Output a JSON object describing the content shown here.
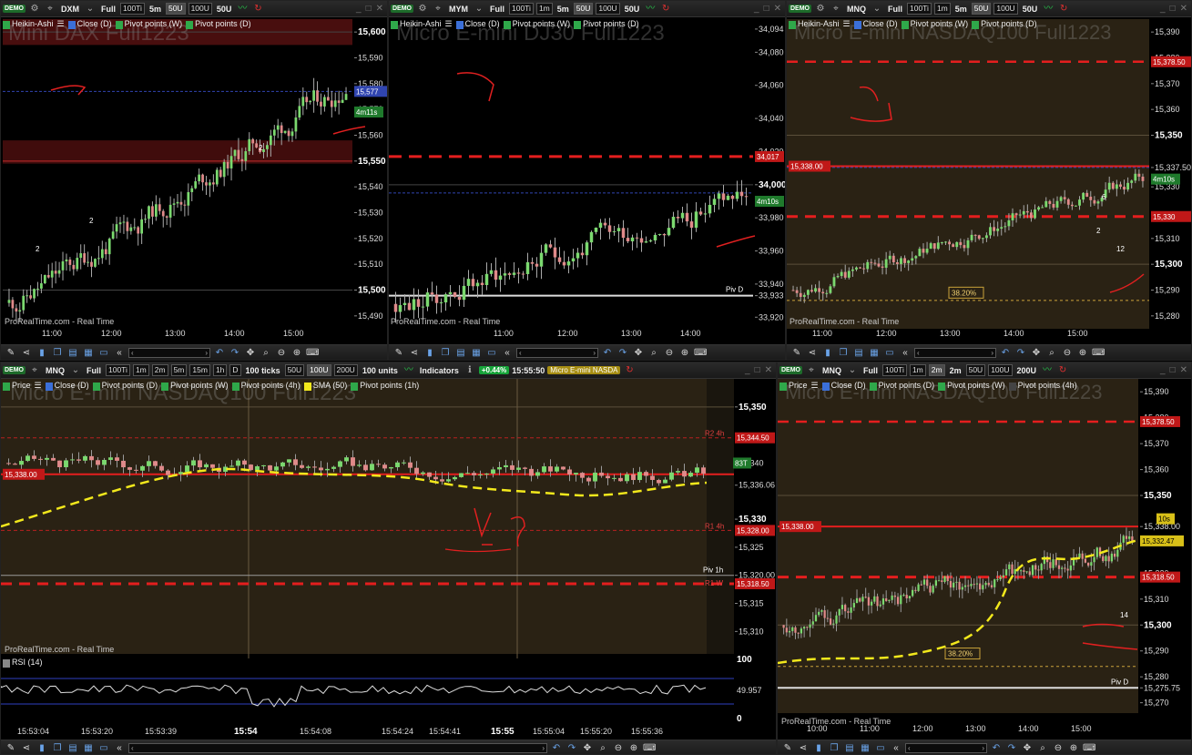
{
  "colors": {
    "up": "#7bd96f",
    "down": "#e08a8a",
    "pivot_red": "#e41e1e",
    "sma_yellow": "#f2e81c",
    "bg_dark": "#000000",
    "bg_brown": "#2a2214",
    "rsi_blue": "#3040c0"
  },
  "panels": [
    {
      "id": "dax",
      "toolbar": {
        "symbol": "DXM",
        "mode": "Full",
        "ticks": "100Ti",
        "interval": "5m",
        "units": [
          "50U",
          "100U",
          "50U"
        ]
      },
      "legend": [
        {
          "color": "#2fa84a",
          "label": "Heikin-Ashi"
        },
        {
          "color": "#3b6fd8",
          "label": "Close (D)"
        },
        {
          "color": "#2fa84a",
          "label": "Pivot points (W)"
        },
        {
          "color": "#2fa84a",
          "label": "Pivot points (D)"
        }
      ],
      "watermark": "Mini DAX Full1223",
      "source_label": "ProRealTime.com - Real Time",
      "y_ticks": [
        "15,600",
        "15,590",
        "15,580",
        "15,570",
        "15,560",
        "15,550",
        "15,540",
        "15,530",
        "15,520",
        "15,510",
        "15,500",
        "15,490"
      ],
      "x_ticks": [
        "11:00",
        "12:00",
        "13:00",
        "14:00",
        "15:00"
      ],
      "price_tags": [
        "15,577",
        "4m11s"
      ],
      "annotations": [
        "2",
        "2",
        "2"
      ]
    },
    {
      "id": "dj30",
      "toolbar": {
        "symbol": "MYM",
        "mode": "Full",
        "ticks": "100Ti",
        "interval2": "1m",
        "interval": "5m",
        "units": [
          "50U",
          "100U",
          "50U"
        ]
      },
      "legend": [
        {
          "color": "#2fa84a",
          "label": "Heikin-Ashi"
        },
        {
          "color": "#3b6fd8",
          "label": "Close (D)"
        },
        {
          "color": "#2fa84a",
          "label": "Pivot points (W)"
        },
        {
          "color": "#2fa84a",
          "label": "Pivot points (D)"
        }
      ],
      "watermark": "Micro E-mini DJ30 Full1223",
      "source_label": "ProRealTime.com - Real Time",
      "y_ticks": [
        "34,094",
        "34,080",
        "34,060",
        "34,040",
        "34,020",
        "34,017",
        "34,000",
        "33,980",
        "33,960",
        "33,940",
        "33,933",
        "33,920"
      ],
      "x_ticks": [
        "11:00",
        "12:00",
        "13:00",
        "14:00",
        "15:00"
      ],
      "price_tags": [
        "33,995",
        "4m10s"
      ],
      "line_labels": [
        "Piv D"
      ]
    },
    {
      "id": "nq1",
      "toolbar": {
        "symbol": "MNQ",
        "mode": "Full",
        "ticks": "100Ti",
        "interval2": "1m",
        "interval": "5m",
        "units": [
          "50U",
          "100U",
          "50U"
        ]
      },
      "legend": [
        {
          "color": "#2fa84a",
          "label": "Heikin-Ashi"
        },
        {
          "color": "#3b6fd8",
          "label": "Close (D)"
        },
        {
          "color": "#2fa84a",
          "label": "Pivot points (W)"
        },
        {
          "color": "#2fa84a",
          "label": "Pivot points (D)"
        }
      ],
      "watermark": "Micro E-mini NASDAQ100 Full1223",
      "source_label": "ProRealTime.com - Real Time",
      "y_ticks": [
        "15,390",
        "15,380",
        "15,378.50",
        "15,370",
        "15,360",
        "15,350",
        "15,337.50",
        "15,330",
        "15,318.50",
        "15,310",
        "15,300",
        "15,290",
        "15,280"
      ],
      "x_ticks": [
        "11:00",
        "12:00",
        "13:00",
        "14:00",
        "15:00"
      ],
      "price_tags": [
        "15,338.00",
        "4m10s"
      ],
      "fib_label": "38.20%",
      "annotations": [
        "2",
        "12",
        "6"
      ]
    },
    {
      "id": "nq-tick",
      "toolbar": {
        "symbol": "MNQ",
        "mode": "Full",
        "ticks": "100Ti",
        "intervals": [
          "1m",
          "2m",
          "5m",
          "15m",
          "1h",
          "D"
        ],
        "tick_mode": "100 ticks",
        "units": [
          "50U",
          "100U",
          "200U"
        ],
        "unit_mode": "100 units",
        "indicators": "Indicators",
        "change": "+0.44%",
        "time": "15:55:50",
        "instrument": "Micro E-mini NASDA"
      },
      "legend": [
        {
          "color": "#2fa84a",
          "label": "Price"
        },
        {
          "color": "#3b6fd8",
          "label": "Close (D)"
        },
        {
          "color": "#2fa84a",
          "label": "Pivot points (D)"
        },
        {
          "color": "#2fa84a",
          "label": "Pivot points (W)"
        },
        {
          "color": "#2fa84a",
          "label": "Pivot points (4h)"
        },
        {
          "color": "#f2e81c",
          "label": "SMA (50)"
        },
        {
          "color": "#2fa84a",
          "label": "Pivot points (1h)"
        }
      ],
      "watermark": "Micro E-mini NASDAQ100 Full1223",
      "source_label": "ProRealTime.com - Real Time",
      "y_ticks": [
        "15,350",
        "15,344.50",
        "15,340",
        "15,336.06",
        "15,330",
        "15,328.00",
        "15,325",
        "15,320.00",
        "15,318.50",
        "15,315",
        "15,310"
      ],
      "x_ticks": [
        "15:53:04",
        "15:53:20",
        "15:53:39",
        "15:54",
        "15:54:08",
        "15:54:24",
        "15:54:41",
        "15:55",
        "15:55:04",
        "15:55:20",
        "15:55:36"
      ],
      "price_tags": [
        "15,338.00",
        "83T"
      ],
      "line_labels": [
        "R2 4h",
        "R1 4h",
        "Piv 1h",
        "R1 W"
      ],
      "rsi": {
        "label": "RSI (14)",
        "ticks": [
          "100",
          "49.957",
          "0"
        ]
      }
    },
    {
      "id": "nq2",
      "toolbar": {
        "symbol": "MNQ",
        "mode": "Full",
        "ticks": "100Ti",
        "interval2": "1m",
        "interval_active": "2m",
        "interval": "2m",
        "units": [
          "50U",
          "100U",
          "200U"
        ]
      },
      "legend": [
        {
          "color": "#2fa84a",
          "label": "Price"
        },
        {
          "color": "#3b6fd8",
          "label": "Close (D)"
        },
        {
          "color": "#2fa84a",
          "label": "Pivot points (D)"
        },
        {
          "color": "#2fa84a",
          "label": "Pivot points (W)"
        },
        {
          "color": "#444444",
          "label": "Pivot points (4h)"
        }
      ],
      "watermark": "Micro E-mini NASDAQ100 Full1223",
      "source_label": "ProRealTime.com - Real Time",
      "y_ticks": [
        "15,390",
        "15,380",
        "15,378.50",
        "15,370",
        "15,360",
        "15,350",
        "15,338.00",
        "15,332.47",
        "15,320",
        "15,318.50",
        "15,310",
        "15,300",
        "15,290",
        "15,280",
        "15,275.75",
        "15,270"
      ],
      "x_ticks": [
        "10:00",
        "11:00",
        "12:00",
        "13:00",
        "14:00",
        "15:00"
      ],
      "price_tags": [
        "15,338.00",
        "10s"
      ],
      "fib_label": "38.20%",
      "line_labels": [
        "Piv D"
      ],
      "annotations": [
        "14"
      ]
    }
  ]
}
